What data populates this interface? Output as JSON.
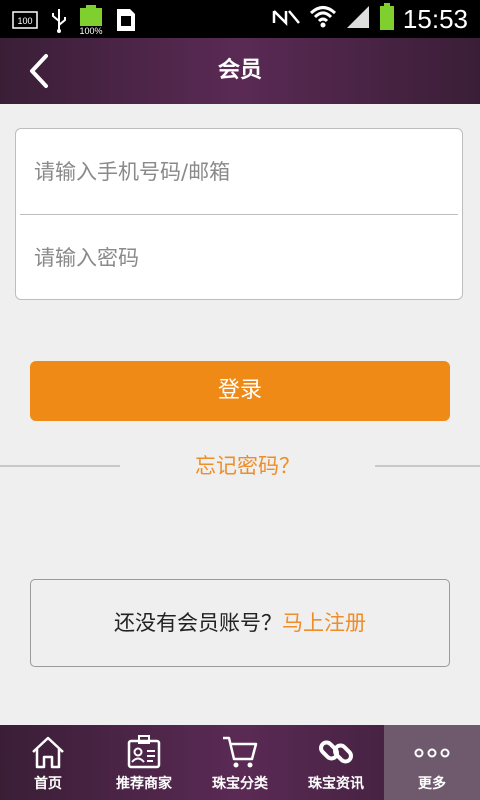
{
  "status_bar": {
    "left_icons": [
      "battery-100-icon",
      "usb-icon",
      "battery-charging-icon",
      "sim-icon"
    ],
    "battery_small_text": "100",
    "battery_percent_text": "100%",
    "right_icons": [
      "nfc-mute-icon",
      "wifi-icon",
      "signal-icon",
      "battery-icon"
    ],
    "time": "15:53"
  },
  "header": {
    "title": "会员",
    "back_icon": "chevron-left-icon"
  },
  "login": {
    "phone_placeholder": "请输入手机号码/邮箱",
    "password_placeholder": "请输入密码",
    "login_button": "登录",
    "forgot_password": "忘记密码？"
  },
  "register": {
    "prompt": "还没有会员账号？",
    "link": "马上注册"
  },
  "bottom_nav": {
    "items": [
      {
        "label": "首页",
        "icon": "home-icon"
      },
      {
        "label": "推荐商家",
        "icon": "contact-card-icon"
      },
      {
        "label": "珠宝分类",
        "icon": "cart-icon"
      },
      {
        "label": "珠宝资讯",
        "icon": "link-icon"
      },
      {
        "label": "更多",
        "icon": "more-dots-icon"
      }
    ],
    "active_index": 4
  },
  "colors": {
    "accent": "#f08a17",
    "link": "#ee8e2a",
    "header_bg": "#4a2346"
  }
}
